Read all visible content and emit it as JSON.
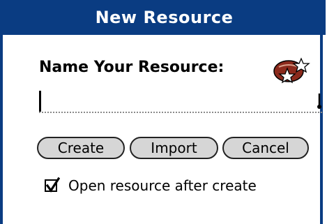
{
  "dialog": {
    "title": "New Resource",
    "prompt": "Name Your Resource:",
    "name_value": ""
  },
  "buttons": {
    "create": "Create",
    "import": "Import",
    "cancel": "Cancel"
  },
  "options": {
    "open_after_create_label": "Open resource after create",
    "open_after_create_checked": true
  },
  "icons": {
    "app_icon": "resource-app-icon",
    "graffiti": "graffiti-shift-icon",
    "check": "checkmark-icon"
  },
  "colors": {
    "title_bar": "#0a3c82",
    "button_face": "#d6d6d6",
    "app_icon_red": "#8b2a1c"
  }
}
